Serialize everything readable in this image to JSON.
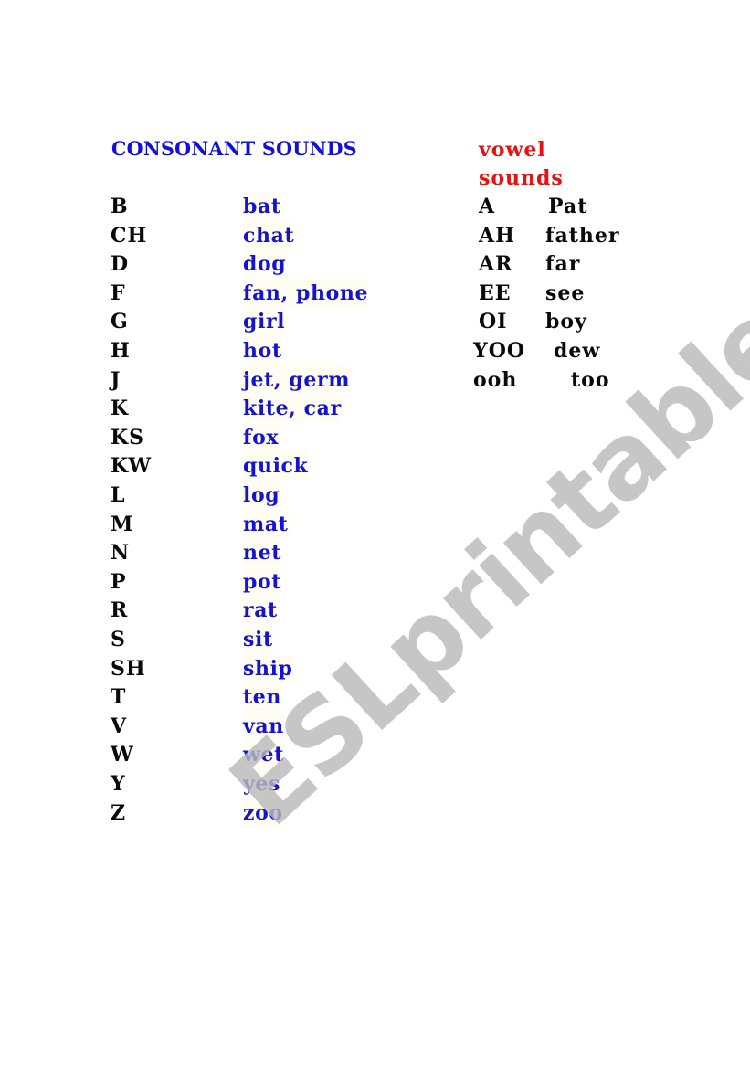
{
  "headings": {
    "consonants": "CONSONANT SOUNDS",
    "vowels": "vowel sounds"
  },
  "consonants": [
    {
      "code": "B",
      "word": "bat"
    },
    {
      "code": "CH",
      "word": "chat"
    },
    {
      "code": "D",
      "word": "dog"
    },
    {
      "code": "F",
      "word": "fan, phone"
    },
    {
      "code": "G",
      "word": "girl"
    },
    {
      "code": "H",
      "word": "hot"
    },
    {
      "code": "J",
      "word": "jet, germ"
    },
    {
      "code": "K",
      "word": "kite, car"
    },
    {
      "code": "KS",
      "word": "fox"
    },
    {
      "code": "KW",
      "word": "quick"
    },
    {
      "code": "L",
      "word": "log"
    },
    {
      "code": "M",
      "word": "mat"
    },
    {
      "code": "N",
      "word": "net"
    },
    {
      "code": "P",
      "word": "pot"
    },
    {
      "code": "R",
      "word": "rat"
    },
    {
      "code": "S",
      "word": "sit"
    },
    {
      "code": "SH",
      "word": "ship"
    },
    {
      "code": "T",
      "word": "ten"
    },
    {
      "code": "V",
      "word": "van"
    },
    {
      "code": "W",
      "word": "wet"
    },
    {
      "code": "Y",
      "word": "yes"
    },
    {
      "code": "Z",
      "word": "zoo"
    }
  ],
  "vowels": [
    {
      "code": "A",
      "word": "Pat"
    },
    {
      "code": "AH",
      "word": "father"
    },
    {
      "code": "AR",
      "word": "far"
    },
    {
      "code": "EE",
      "word": "see"
    },
    {
      "code": "OI",
      "word": "boy"
    },
    {
      "code": "YOO",
      "word": "dew"
    },
    {
      "code": "ooh",
      "word": "too"
    }
  ],
  "watermark": "ESLprintables.com",
  "colors": {
    "consonant_heading": "#1010d8",
    "vowel_heading": "#e81010",
    "consonant_words": "#1414d0",
    "codes": "#0a0a0a",
    "watermark": "#b9b9b9"
  }
}
